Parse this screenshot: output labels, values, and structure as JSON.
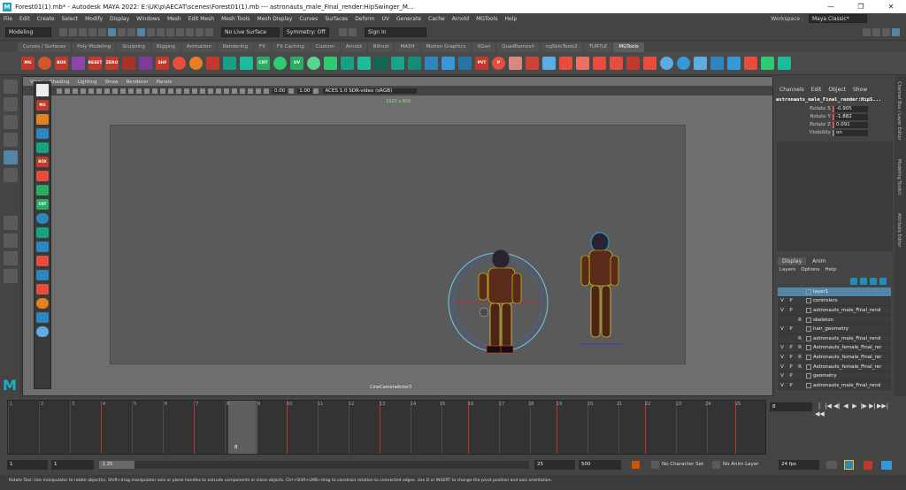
{
  "titlebar": {
    "title": "Forest01(1).mb* - Autodesk MAYA 2022: E:\\UK\\p\\AECAT\\scenes\\Forest01(1).mb  ---  astronauts_male_Final_render:HipSwinger_M...",
    "minimize": "—",
    "restore": "❐",
    "close": "✕"
  },
  "menubar": {
    "items": [
      "File",
      "Edit",
      "Create",
      "Select",
      "Modify",
      "Display",
      "Windows",
      "Mesh",
      "Edit Mesh",
      "Mesh Tools",
      "Mesh Display",
      "Curves",
      "Surfaces",
      "Deform",
      "UV",
      "Generate",
      "Cache",
      "Arnold",
      "MGTools",
      "Help"
    ],
    "workspace_label": "Workspace :",
    "workspace_value": "Maya Classic*"
  },
  "statusline": {
    "mode": "Modeling",
    "live_surface": "No Live Surface",
    "symmetry": "Symmetry: Off",
    "sign_in": "Sign In"
  },
  "shelf_tabs": [
    "Curves / Surfaces",
    "Poly Modeling",
    "Sculpting",
    "Rigging",
    "Animation",
    "Rendering",
    "FX",
    "FX Caching",
    "Custom",
    "Arnold",
    "Bifrost",
    "MASH",
    "Motion Graphics",
    "XGen",
    "QuadRemesh",
    "ngSkinTools2",
    "TURTLE",
    "MGTools"
  ],
  "shelf_active": "MGTools",
  "shelf_icons": [
    "MG",
    "BOX",
    "RESET",
    "ZERO",
    "SHF",
    "CNT",
    "UV",
    "PVT",
    "P"
  ],
  "viewport": {
    "menu": [
      "View",
      "Shading",
      "Lighting",
      "Show",
      "Renderer",
      "Panels"
    ],
    "value_a": "0.00",
    "value_b": "1.00",
    "colorspace": "ACES 1.0 SDR-video (sRGB)",
    "resolution": "1920 x 800",
    "camera": "CineCameraActor3"
  },
  "channelbox": {
    "menu": [
      "Channels",
      "Edit",
      "Object",
      "Show"
    ],
    "object": "astronauts_male_Final_render:HipS...",
    "attrs": [
      {
        "name": "Rotate X",
        "value": "-0.905"
      },
      {
        "name": "Rotate Y",
        "value": "-1.882"
      },
      {
        "name": "Rotate Z",
        "value": "0.091"
      },
      {
        "name": "Visibility",
        "value": "on"
      }
    ]
  },
  "righttabs": [
    "Channel Box / Layer Editor",
    "Modeling Toolkit",
    "Attribute Editor"
  ],
  "layers": {
    "tabs": [
      "Display",
      "Anim"
    ],
    "menu": [
      "Layers",
      "Options",
      "Help"
    ],
    "rows": [
      {
        "v": "",
        "p": "",
        "r": "",
        "name": "layer1",
        "selected": true
      },
      {
        "v": "V",
        "p": "P",
        "r": "",
        "name": "controlers",
        "selected": false
      },
      {
        "v": "V",
        "p": "P",
        "r": "",
        "name": "astronauts_male_Final_rend",
        "selected": false
      },
      {
        "v": "",
        "p": "",
        "r": "R",
        "name": "skeleton",
        "selected": false
      },
      {
        "v": "V",
        "p": "P",
        "r": "",
        "name": "hair_geometry",
        "selected": false
      },
      {
        "v": "",
        "p": "",
        "r": "R",
        "name": "astronauts_male_Final_rend",
        "selected": false
      },
      {
        "v": "V",
        "p": "P",
        "r": "R",
        "name": "Astronauts_female_Final_rer",
        "selected": false
      },
      {
        "v": "V",
        "p": "P",
        "r": "R",
        "name": "Astronauts_female_Final_rer",
        "selected": false
      },
      {
        "v": "V",
        "p": "P",
        "r": "R",
        "name": "Astronauts_female_Final_rer",
        "selected": false
      },
      {
        "v": "V",
        "p": "P",
        "r": "",
        "name": "geometry",
        "selected": false
      },
      {
        "v": "V",
        "p": "P",
        "r": "",
        "name": "astronauts_male_Final_rend",
        "selected": false
      }
    ]
  },
  "timeline": {
    "numbers": [
      "1",
      "2",
      "3",
      "4",
      "5",
      "6",
      "7",
      "8",
      "9",
      "10",
      "11",
      "12",
      "13",
      "14",
      "15",
      "16",
      "17",
      "18",
      "19",
      "20",
      "21",
      "22",
      "23",
      "24",
      "25"
    ],
    "current": "8",
    "current_field": "8",
    "playback_icons": [
      "|◀◀",
      "|◀",
      "◀|",
      "◀",
      "▶",
      "|▶",
      "▶|",
      "▶▶|"
    ]
  },
  "range": {
    "start": "1",
    "start_inner": "1",
    "slider_label": "1   25",
    "end_inner": "25",
    "end": "500",
    "character_set": "No Character Set",
    "anim_layer": "No Anim Layer",
    "fps": "24 fps"
  },
  "helpline": {
    "text": "Rotate Tool: Use manipulator to rotate object(s). Shift+drag manipulator axis or plane handles to extrude components or clone objects. Ctrl+Shift+LMB+drag to constrain rotation to connected edges. Use D or INSERT to change the pivot position and axis orientation."
  }
}
